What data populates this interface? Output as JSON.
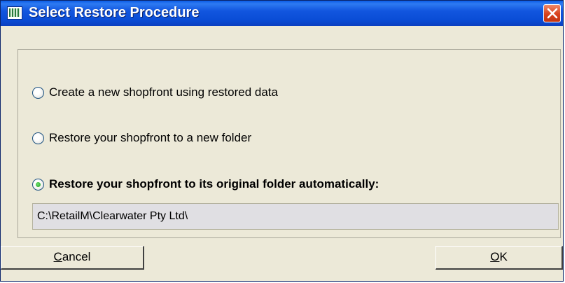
{
  "window": {
    "title": "Select Restore Procedure"
  },
  "options": [
    {
      "label": "Create a new shopfront using restored data",
      "selected": false
    },
    {
      "label": "Restore your shopfront to a new folder",
      "selected": false
    },
    {
      "label": "Restore your shopfront to its original folder automatically:",
      "selected": true
    }
  ],
  "path_field": {
    "value": "C:\\RetailM\\Clearwater Pty Ltd\\"
  },
  "buttons": {
    "cancel": {
      "accel": "C",
      "rest": "ancel"
    },
    "ok": {
      "accel": "O",
      "rest": "K"
    }
  },
  "colors": {
    "titlebar": "#0a4dd6",
    "dialog_bg": "#ece9d8",
    "close": "#d8421c",
    "radio_dot": "#1f9a1f"
  }
}
